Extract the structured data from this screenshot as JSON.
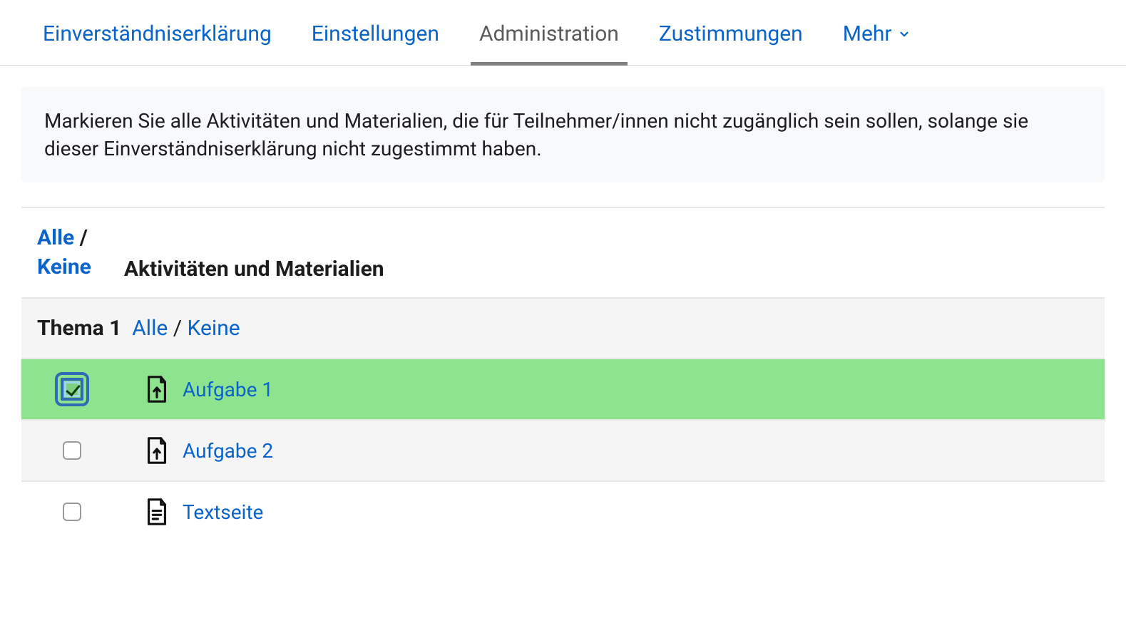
{
  "tabs": {
    "t0": "Einverständniserklärung",
    "t1": "Einstellungen",
    "t2": "Administration",
    "t3": "Zustimmungen",
    "t4": "Mehr"
  },
  "active_tab": "t2",
  "info_text": "Markieren Sie alle Aktivitäten und Materialien, die für Teilnehmer/innen nicht zugänglich sein sollen, solange sie dieser Einverständniserklärung nicht zugestimmt haben.",
  "select": {
    "all": "Alle",
    "none": "Keine",
    "column_title": "Aktivitäten und Materialien"
  },
  "section": {
    "title": "Thema 1",
    "all": "Alle",
    "none": "Keine"
  },
  "items": [
    {
      "label": "Aufgabe 1",
      "icon": "assignment-icon",
      "checked": true,
      "focused": true,
      "highlight": true
    },
    {
      "label": "Aufgabe 2",
      "icon": "assignment-icon",
      "checked": false,
      "focused": false,
      "highlight": false
    },
    {
      "label": "Textseite",
      "icon": "page-icon",
      "checked": false,
      "focused": false,
      "highlight": false
    }
  ]
}
